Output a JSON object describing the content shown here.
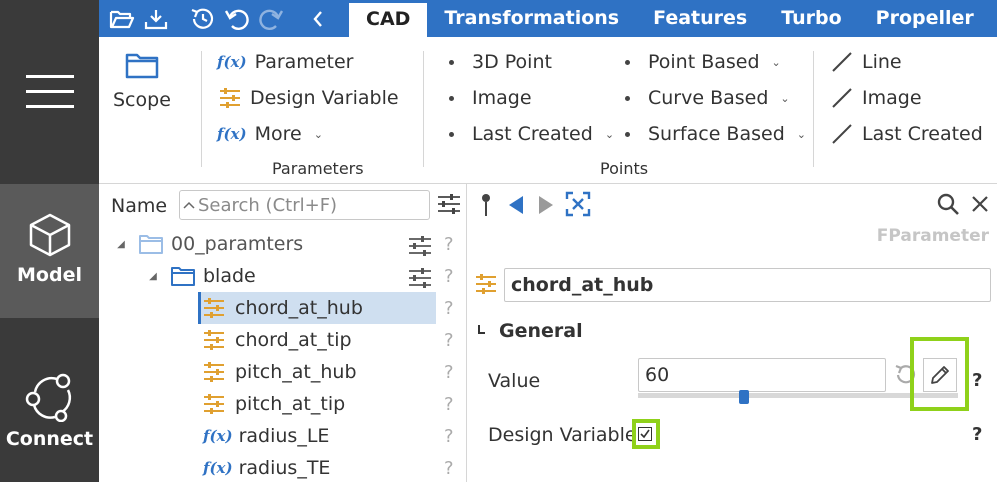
{
  "rail": {
    "model_label": "Model",
    "connect_label": "Connect"
  },
  "tabs": [
    "CAD",
    "Transformations",
    "Features",
    "Turbo",
    "Propeller"
  ],
  "ribbon": {
    "scope_label": "Scope",
    "parameters": {
      "fx_glyph": "f(x)",
      "parameter": "Parameter",
      "design_variable": "Design Variable",
      "more": "More",
      "group_label": "Parameters"
    },
    "points": {
      "col1": [
        "3D Point",
        "Image",
        "Last Created"
      ],
      "col2": [
        "Point Based",
        "Curve Based",
        "Surface Based"
      ],
      "group_label": "Points"
    },
    "lines": [
      "Line",
      "Image",
      "Last Created"
    ],
    "caret": "⌄"
  },
  "tree": {
    "name_header": "Name",
    "search_placeholder": "Search (Ctrl+F)",
    "help": "?",
    "folder_root": "00_paramters",
    "folder_child": "blade",
    "items": [
      {
        "label": "chord_at_hub",
        "icon": "design-variable-icon"
      },
      {
        "label": "chord_at_tip",
        "icon": "design-variable-icon"
      },
      {
        "label": "pitch_at_hub",
        "icon": "design-variable-icon"
      },
      {
        "label": "pitch_at_tip",
        "icon": "design-variable-icon"
      },
      {
        "label": "radius_LE",
        "icon": "function-icon"
      },
      {
        "label": "radius_TE",
        "icon": "function-icon"
      }
    ]
  },
  "props": {
    "type_label": "FParameter",
    "name_value": "chord_at_hub",
    "section_label": "General",
    "value_label": "Value",
    "value": "60",
    "slider_fraction": 0.33,
    "design_variable_label": "Design Variable",
    "design_variable_checked": true,
    "help": "?"
  },
  "colors": {
    "accent": "#2f72c4",
    "highlight": "#8fd11a",
    "param_icon": "#e0a030",
    "rail": "#3a3a3a"
  }
}
